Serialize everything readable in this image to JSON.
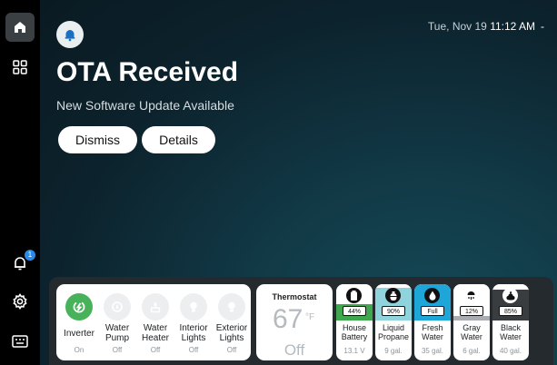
{
  "clock": {
    "date": "Tue, Nov 19",
    "time": "11:12 AM"
  },
  "sidebar": {
    "notification_badge": "1"
  },
  "notification": {
    "title": "OTA Received",
    "subtitle": "New Software Update Available",
    "dismiss_label": "Dismiss",
    "details_label": "Details"
  },
  "loads": [
    {
      "label": "Inverter",
      "state": "On",
      "icon": "power-icon"
    },
    {
      "label": "Water Pump",
      "state": "Off",
      "icon": "water-pump-icon"
    },
    {
      "label": "Water Heater",
      "state": "Off",
      "icon": "water-heater-icon"
    },
    {
      "label": "Interior Lights",
      "state": "Off",
      "icon": "bulb-icon"
    },
    {
      "label": "Exterior Lights",
      "state": "Off",
      "icon": "bulb-icon"
    }
  ],
  "thermostat": {
    "label": "Thermostat",
    "value": "67",
    "unit": "°F",
    "state": "Off"
  },
  "tanks": [
    {
      "label": "House Battery",
      "percent": "44%",
      "value": "13.1 V",
      "level": 0.44,
      "color": "#3fa84f",
      "icon": "battery-icon"
    },
    {
      "label": "Liquid Propane",
      "percent": "90%",
      "value": "9 gal.",
      "level": 0.9,
      "color": "#8fd3dd",
      "icon": "propane-tank-icon"
    },
    {
      "label": "Fresh Water",
      "percent": "Full",
      "value": "35 gal.",
      "level": 1.0,
      "color": "#1ea6d9",
      "icon": "water-drop-icon"
    },
    {
      "label": "Gray Water",
      "percent": "12%",
      "value": "6 gal.",
      "level": 0.12,
      "color": "#a9adb1",
      "icon": "shower-icon"
    },
    {
      "label": "Black Water",
      "percent": "85%",
      "value": "40 gal.",
      "level": 0.85,
      "color": "#3a3d40",
      "icon": "waste-icon"
    }
  ]
}
